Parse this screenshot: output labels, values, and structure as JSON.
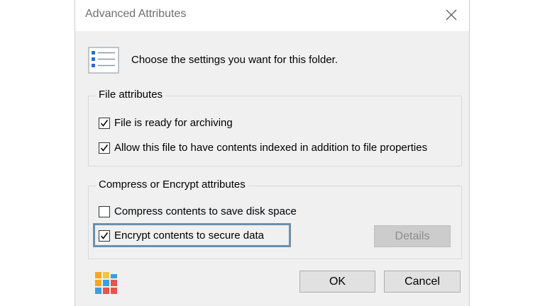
{
  "window": {
    "title": "Advanced Attributes",
    "close_icon": "close-icon"
  },
  "intro": {
    "icon": "checklist-icon",
    "text": "Choose the settings you want for this folder."
  },
  "file_attributes": {
    "label": "File attributes",
    "options": [
      {
        "label": "File is ready for archiving",
        "checked": true
      },
      {
        "label": "Allow this file to have contents indexed in addition to file properties",
        "checked": true
      }
    ]
  },
  "compress_encrypt": {
    "label": "Compress or Encrypt attributes",
    "options": [
      {
        "label": "Compress contents to save disk space",
        "checked": false
      },
      {
        "label": "Encrypt contents to secure data",
        "checked": true,
        "highlighted": true
      }
    ],
    "details_button": {
      "label": "Details",
      "enabled": false
    }
  },
  "footer": {
    "ok_label": "OK",
    "cancel_label": "Cancel",
    "logo": "windows-app-logo"
  },
  "colors": {
    "highlight_border": "#6e8faa",
    "dialog_background": "#f0f0f0"
  }
}
